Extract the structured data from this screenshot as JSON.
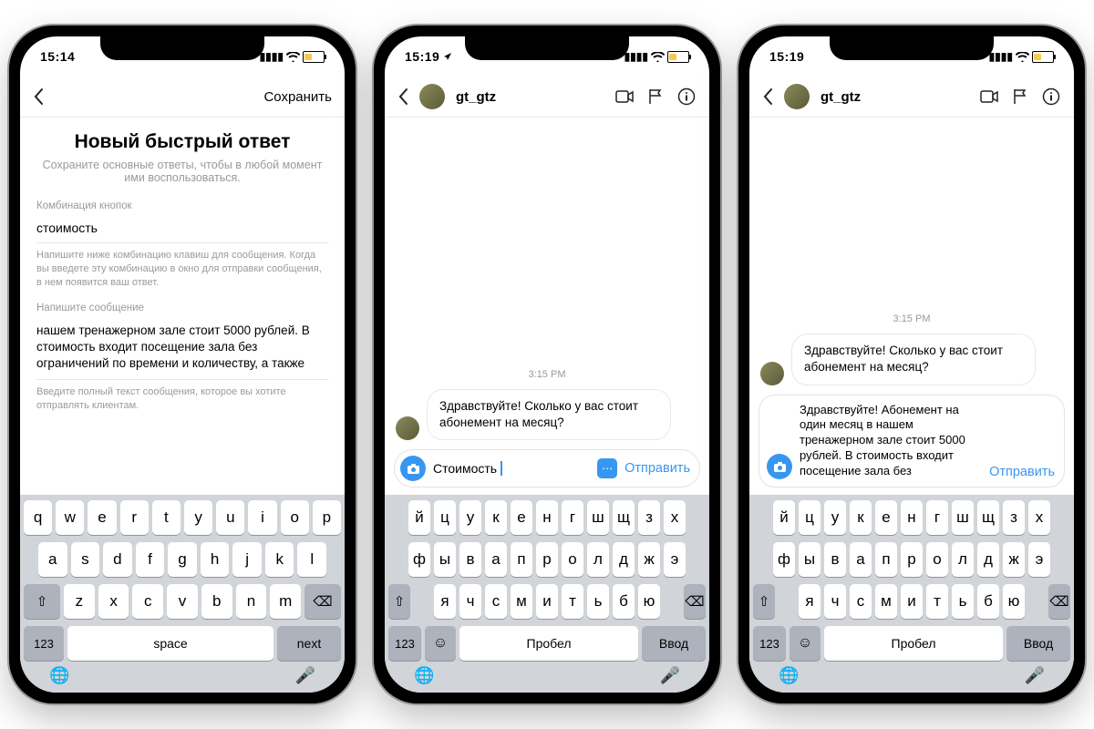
{
  "phones": {
    "settings": {
      "status_time": "15:14",
      "save_label": "Сохранить",
      "title": "Новый быстрый ответ",
      "subtitle": "Сохраните основные ответы, чтобы в любой момент ими воспользоваться.",
      "shortcut_label": "Комбинация кнопок",
      "shortcut_value": "стоимость",
      "shortcut_help": "Напишите ниже комбинацию клавиш для сообщения. Когда вы введете эту комбинацию в окно для отправки сообщения, в нем появится ваш ответ.",
      "message_label": "Напишите сообщение",
      "message_value": "нашем тренажерном зале стоит 5000 рублей. В стоимость входит посещение зала без ограничений по времени и количеству, а также",
      "message_help": "Введите полный текст сообщения, которое вы хотите отправлять клиентам."
    },
    "chat1": {
      "status_time": "15:19",
      "username": "gt_gtz",
      "timestamp": "3:15 PM",
      "incoming_msg": "Здравствуйте! Сколько у вас стоит абонемент на месяц?",
      "compose_text": "Стоимость",
      "send_label": "Отправить"
    },
    "chat2": {
      "status_time": "15:19",
      "username": "gt_gtz",
      "timestamp": "3:15 PM",
      "incoming_msg": "Здравствуйте! Сколько у вас стоит абонемент на месяц?",
      "compose_text": "Здравствуйте! Абонемент на один месяц в нашем тренажерном зале стоит 5000 рублей. В стоимость входит посещение зала без",
      "send_label": "Отправить"
    }
  },
  "keyboard_en": {
    "row1": [
      "q",
      "w",
      "e",
      "r",
      "t",
      "y",
      "u",
      "i",
      "o",
      "p"
    ],
    "row2": [
      "a",
      "s",
      "d",
      "f",
      "g",
      "h",
      "j",
      "k",
      "l"
    ],
    "row3": [
      "z",
      "x",
      "c",
      "v",
      "b",
      "n",
      "m"
    ],
    "num": "123",
    "space": "space",
    "ret": "next"
  },
  "keyboard_ru": {
    "row1": [
      "й",
      "ц",
      "у",
      "к",
      "е",
      "н",
      "г",
      "ш",
      "щ",
      "з",
      "х"
    ],
    "row2": [
      "ф",
      "ы",
      "в",
      "а",
      "п",
      "р",
      "о",
      "л",
      "д",
      "ж",
      "э"
    ],
    "row3": [
      "я",
      "ч",
      "с",
      "м",
      "и",
      "т",
      "ь",
      "б",
      "ю"
    ],
    "num": "123",
    "space": "Пробел",
    "ret": "Ввод"
  }
}
